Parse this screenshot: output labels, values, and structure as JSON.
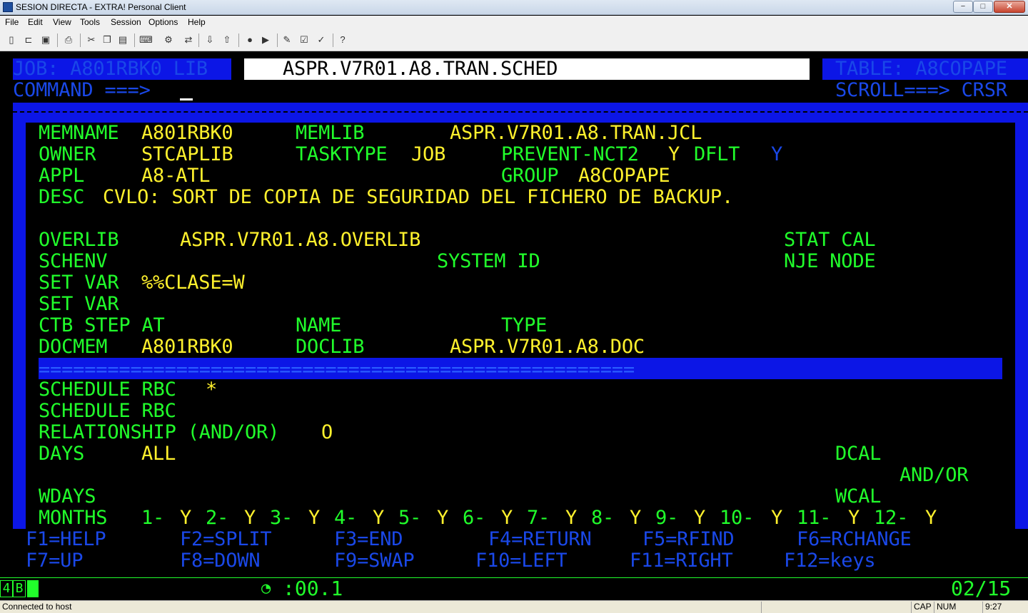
{
  "window": {
    "title": "SESION DIRECTA - EXTRA! Personal Client",
    "min": "−",
    "max": "□",
    "close": "✕"
  },
  "menu": [
    "File",
    "Edit",
    "View",
    "Tools",
    "Session",
    "Options",
    "Help"
  ],
  "toolbar_icons": [
    "new-icon",
    "open-icon",
    "save-icon",
    "print-icon",
    "cut-icon",
    "copy-icon",
    "paste-icon",
    "macro-icon",
    "settings-icon",
    "transfer-icon",
    "receive-icon",
    "record-icon",
    "play-icon",
    "edit-macro-icon",
    "run-icon",
    "send-icon",
    "help-icon"
  ],
  "screen": {
    "header": {
      "job_label": "JOB: A801RBK0 LIB",
      "lib_value": "ASPR.V7R01.A8.TRAN.SCHED",
      "table_label": "TABLE: A8COPAPE",
      "command_label": "COMMAND ===>",
      "command_value": "",
      "scroll_label": "SCROLL===> CRSR"
    },
    "rows": {
      "memname_label": "MEMNAME",
      "memname": "A801RBK0",
      "memlib_label": "MEMLIB",
      "memlib": "ASPR.V7R01.A8.TRAN.JCL",
      "owner_label": "OWNER",
      "owner": "STCAPLIB",
      "tasktype_label": "TASKTYPE",
      "tasktype": "JOB",
      "prevent_label": "PREVENT-NCT2",
      "prevent": "Y",
      "dflt_label": "DFLT",
      "dflt": "Y",
      "appl_label": "APPL",
      "appl": "A8-ATL",
      "group_label": "GROUP",
      "group": "A8COPAPE",
      "desc_label": "DESC",
      "desc": "CVLO: SORT DE COPIA DE SEGURIDAD DEL FICHERO DE BACKUP.",
      "overlib_label": "OVERLIB",
      "overlib": "ASPR.V7R01.A8.OVERLIB",
      "stat_label": "STAT CAL",
      "schenv_label": "SCHENV",
      "systemid_label": "SYSTEM ID",
      "nje_label": "NJE NODE",
      "setvar1_label": "SET VAR",
      "setvar1": "%%CLASE=W",
      "setvar2_label": "SET VAR",
      "ctb_label": "CTB STEP AT",
      "name_label": "NAME",
      "type_label": "TYPE",
      "docmem_label": "DOCMEM",
      "docmem": "A801RBK0",
      "doclib_label": "DOCLIB",
      "doclib": "ASPR.V7R01.A8.DOC",
      "separator": "====================================================",
      "sched1_label": "SCHEDULE RBC",
      "sched1": "*",
      "sched2_label": "SCHEDULE RBC",
      "relationship_label": "RELATIONSHIP (AND/OR)",
      "relationship": "O",
      "days_label": "DAYS",
      "days": "ALL",
      "dcal_label": "DCAL",
      "andor_label": "AND/OR",
      "wdays_label": "WDAYS",
      "wcal_label": "WCAL",
      "months_label": "MONTHS",
      "months": [
        {
          "label": "1-",
          "value": "Y"
        },
        {
          "label": "2-",
          "value": "Y"
        },
        {
          "label": "3-",
          "value": "Y"
        },
        {
          "label": "4-",
          "value": "Y"
        },
        {
          "label": "5-",
          "value": "Y"
        },
        {
          "label": "6-",
          "value": "Y"
        },
        {
          "label": "7-",
          "value": "Y"
        },
        {
          "label": "8-",
          "value": "Y"
        },
        {
          "label": "9-",
          "value": "Y"
        },
        {
          "label": "10-",
          "value": "Y"
        },
        {
          "label": "11-",
          "value": "Y"
        },
        {
          "label": "12-",
          "value": "Y"
        }
      ]
    },
    "pf_keys": {
      "f1": "F1=HELP",
      "f2": "F2=SPLIT",
      "f3": "F3=END",
      "f4": "F4=RETURN",
      "f5": "F5=RFIND",
      "f6": "F6=RCHANGE",
      "f7": "F7=UP",
      "f8": "F8=DOWN",
      "f9": "F9=SWAP",
      "f10": "F10=LEFT",
      "f11": "F11=RIGHT",
      "f12": "F12=keys"
    }
  },
  "oia": {
    "session": "4",
    "session_b": "B",
    "timer": ":00.1",
    "cursor_pos": "02/15"
  },
  "statusbar": {
    "connection": "Connected to host",
    "cap": "CAP",
    "num": "NUM",
    "time": "9:27"
  }
}
